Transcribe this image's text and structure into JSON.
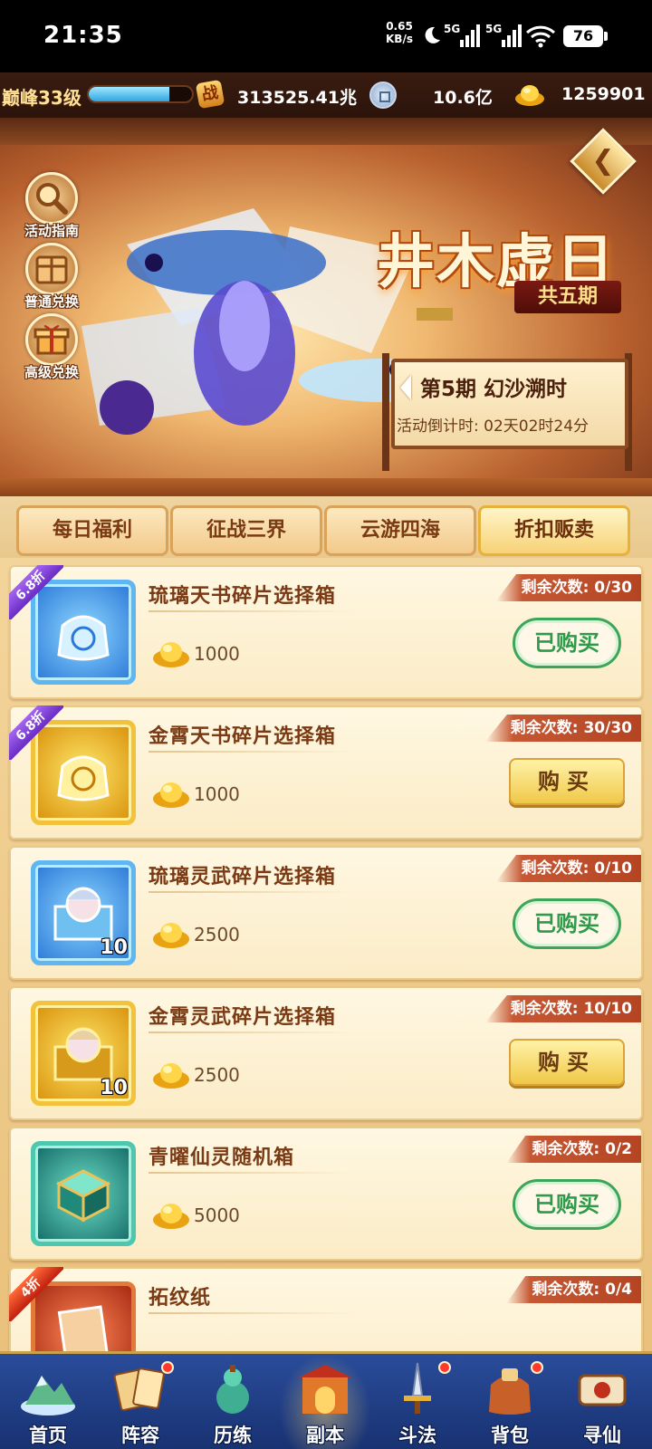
{
  "status_bar": {
    "time": "21:35",
    "net_speed_value": "0.65",
    "net_speed_unit": "KB/s",
    "signal1_label": "5G",
    "signal2_label": "5G",
    "battery": "76"
  },
  "resources": {
    "level": "巅峰33级",
    "exp_fraction": 0.78,
    "combat_icon_char": "战",
    "combat_power": "313525.41兆",
    "silver": "10.6亿",
    "gold": "1259901"
  },
  "banner": {
    "title": "井木虚日",
    "subtitle": "共五期",
    "back_icon": "back-arrow-icon",
    "side_buttons": [
      {
        "label": "活动指南",
        "icon": "magnifier-icon"
      },
      {
        "label": "普通兑换",
        "icon": "exchange-box-icon"
      },
      {
        "label": "高级兑换",
        "icon": "gift-box-icon"
      }
    ],
    "period_name": "第5期  幻沙溯时",
    "countdown": "活动倒计时: 02天02时24分"
  },
  "tabs": [
    {
      "label": "每日福利",
      "active": false
    },
    {
      "label": "征战三界",
      "active": false
    },
    {
      "label": "云游四海",
      "active": false
    },
    {
      "label": "折扣贩卖",
      "active": true
    }
  ],
  "items": [
    {
      "name": "琉璃天书碎片选择箱",
      "price": "1000",
      "remaining": "剩余次数: 0/30",
      "discount": "6.8折",
      "button": "已购买",
      "state": "bought",
      "icon_color": "blue",
      "count": ""
    },
    {
      "name": "金霄天书碎片选择箱",
      "price": "1000",
      "remaining": "剩余次数: 30/30",
      "discount": "6.8折",
      "button": "购买",
      "state": "buy",
      "icon_color": "gold",
      "count": ""
    },
    {
      "name": "琉璃灵武碎片选择箱",
      "price": "2500",
      "remaining": "剩余次数: 0/10",
      "discount": "",
      "button": "已购买",
      "state": "bought",
      "icon_color": "blue",
      "count": "10"
    },
    {
      "name": "金霄灵武碎片选择箱",
      "price": "2500",
      "remaining": "剩余次数: 10/10",
      "discount": "",
      "button": "购买",
      "state": "buy",
      "icon_color": "gold",
      "count": "10"
    },
    {
      "name": "青曜仙灵随机箱",
      "price": "5000",
      "remaining": "剩余次数: 0/2",
      "discount": "",
      "button": "已购买",
      "state": "bought",
      "icon_color": "teal",
      "count": ""
    },
    {
      "name": "拓纹纸",
      "price": "",
      "remaining": "剩余次数: 0/4",
      "discount": "4折",
      "button": "",
      "state": "partial",
      "icon_color": "red",
      "count": ""
    }
  ],
  "bottom_nav": [
    {
      "label": "首页",
      "icon": "home-mountain-icon",
      "dot": false,
      "active": false
    },
    {
      "label": "阵容",
      "icon": "lineup-cards-icon",
      "dot": true,
      "active": false
    },
    {
      "label": "历练",
      "icon": "training-gourd-icon",
      "dot": false,
      "active": false
    },
    {
      "label": "副本",
      "icon": "dungeon-gate-icon",
      "dot": false,
      "active": true
    },
    {
      "label": "斗法",
      "icon": "battle-sword-icon",
      "dot": true,
      "active": false
    },
    {
      "label": "背包",
      "icon": "backpack-bag-icon",
      "dot": true,
      "active": false
    },
    {
      "label": "寻仙",
      "icon": "seek-scroll-icon",
      "dot": false,
      "active": false
    }
  ],
  "colors": {
    "bought_green": "#2f9a4a",
    "discount_purple": "#8a48e0",
    "remain_red": "#c65834",
    "nav_blue": "#1f3f88"
  }
}
